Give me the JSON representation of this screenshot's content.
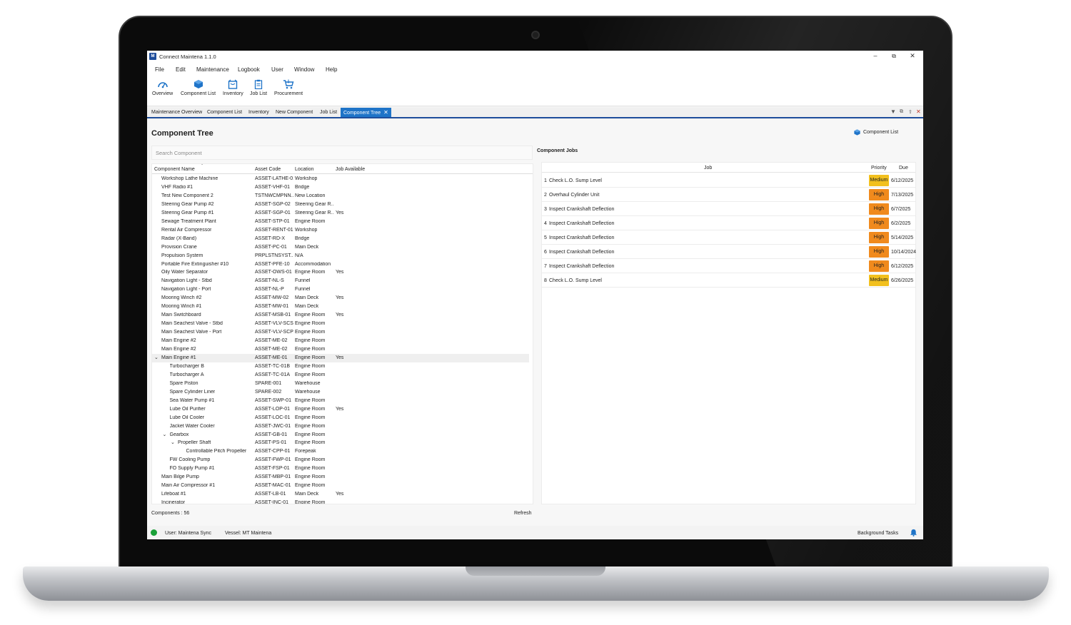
{
  "window": {
    "title": "Connect Maintena 1.1.0",
    "logo_letter": "M"
  },
  "menu": [
    "File",
    "Edit",
    "Maintenance",
    "Logbook",
    "User",
    "Window",
    "Help"
  ],
  "toolbar": [
    {
      "label": "Overview",
      "icon": "gauge-icon"
    },
    {
      "label": "Component List",
      "icon": "cube-icon"
    },
    {
      "label": "Inventory",
      "icon": "inventory-box-icon"
    },
    {
      "label": "Job List",
      "icon": "clipboard-icon"
    },
    {
      "label": "Procurement",
      "icon": "cart-icon"
    }
  ],
  "tabs": [
    {
      "label": "Maintenance Overview",
      "active": false
    },
    {
      "label": "Component List",
      "active": false
    },
    {
      "label": "Inventory",
      "active": false
    },
    {
      "label": "New Component",
      "active": false
    },
    {
      "label": "Job List",
      "active": false
    },
    {
      "label": "Component Tree",
      "active": true,
      "close": "✕"
    }
  ],
  "page": {
    "title": "Component Tree",
    "search_placeholder": "Search Component",
    "component_list_link": "Component List",
    "component_count": "Components : 56",
    "refresh_label": "Refresh"
  },
  "tree": {
    "columns": [
      "Component Name",
      "Asset Code",
      "Location",
      "Job Available"
    ],
    "rows": [
      {
        "name": "Workshop Lathe Machine",
        "code": "ASSET-LATHE-01",
        "location": "Workshop",
        "job": "",
        "level": 0
      },
      {
        "name": "VHF Radio #1",
        "code": "ASSET-VHF-01",
        "location": "Bridge",
        "job": "",
        "level": 0
      },
      {
        "name": "Test New Component 2",
        "code": "TSTNWCMPNN...",
        "location": "New Location",
        "job": "",
        "level": 0
      },
      {
        "name": "Steering Gear Pump #2",
        "code": "ASSET-SGP-02",
        "location": "Steering Gear R...",
        "job": "",
        "level": 0
      },
      {
        "name": "Steering Gear Pump #1",
        "code": "ASSET-SGP-01",
        "location": "Steering Gear R...",
        "job": "Yes",
        "level": 0
      },
      {
        "name": "Sewage Treatment Plant",
        "code": "ASSET-STP-01",
        "location": "Engine Room",
        "job": "",
        "level": 0
      },
      {
        "name": "Rental Air Compressor",
        "code": "ASSET-RENT-01",
        "location": "Workshop",
        "job": "",
        "level": 0
      },
      {
        "name": "Radar (X-Band)",
        "code": "ASSET-RD-X",
        "location": "Bridge",
        "job": "",
        "level": 0
      },
      {
        "name": "Provision Crane",
        "code": "ASSET-PC-01",
        "location": "Main Deck",
        "job": "",
        "level": 0
      },
      {
        "name": "Propulsion System",
        "code": "PRPLSTNSYST...",
        "location": "N/A",
        "job": "",
        "level": 0
      },
      {
        "name": "Portable Fire Extinguisher #10",
        "code": "ASSET-PFE-10",
        "location": "Accommodation",
        "job": "",
        "level": 0
      },
      {
        "name": "Oily Water Separator",
        "code": "ASSET-OWS-01",
        "location": "Engine Room",
        "job": "Yes",
        "level": 0
      },
      {
        "name": "Navigation Light - Stbd",
        "code": "ASSET-NL-S",
        "location": "Funnel",
        "job": "",
        "level": 0
      },
      {
        "name": "Navigation Light - Port",
        "code": "ASSET-NL-P",
        "location": "Funnel",
        "job": "",
        "level": 0
      },
      {
        "name": "Mooring Winch #2",
        "code": "ASSET-MW-02",
        "location": "Main Deck",
        "job": "Yes",
        "level": 0
      },
      {
        "name": "Mooring Winch #1",
        "code": "ASSET-MW-01",
        "location": "Main Deck",
        "job": "",
        "level": 0
      },
      {
        "name": "Main Switchboard",
        "code": "ASSET-MSB-01",
        "location": "Engine Room",
        "job": "Yes",
        "level": 0
      },
      {
        "name": "Main Seachest Valve - Stbd",
        "code": "ASSET-VLV-SCS",
        "location": "Engine Room",
        "job": "",
        "level": 0
      },
      {
        "name": "Main Seachest Valve - Port",
        "code": "ASSET-VLV-SCP",
        "location": "Engine Room",
        "job": "",
        "level": 0
      },
      {
        "name": "Main Engine #2",
        "code": "ASSET-ME-02",
        "location": "Engine Room",
        "job": "",
        "level": 0
      },
      {
        "name": "Main Engine #2",
        "code": "ASSET-ME-02",
        "location": "Engine Room",
        "job": "",
        "level": 0
      },
      {
        "name": "Main Engine #1",
        "code": "ASSET-ME-01",
        "location": "Engine Room",
        "job": "Yes",
        "level": 0,
        "expanded": true,
        "selected": true
      },
      {
        "name": "Turbocharger B",
        "code": "ASSET-TC-01B",
        "location": "Engine Room",
        "job": "",
        "level": 1
      },
      {
        "name": "Turbocharger A",
        "code": "ASSET-TC-01A",
        "location": "Engine Room",
        "job": "",
        "level": 1
      },
      {
        "name": "Spare Piston",
        "code": "SPARE-001",
        "location": "Warehouse",
        "job": "",
        "level": 1
      },
      {
        "name": "Spare Cylinder Liner",
        "code": "SPARE-002",
        "location": "Warehouse",
        "job": "",
        "level": 1
      },
      {
        "name": "Sea Water Pump #1",
        "code": "ASSET-SWP-01",
        "location": "Engine Room",
        "job": "",
        "level": 1
      },
      {
        "name": "Lube Oil Purifier",
        "code": "ASSET-LOP-01",
        "location": "Engine Room",
        "job": "Yes",
        "level": 1
      },
      {
        "name": "Lube Oil Cooler",
        "code": "ASSET-LOC-01",
        "location": "Engine Room",
        "job": "",
        "level": 1
      },
      {
        "name": "Jacket Water Cooler",
        "code": "ASSET-JWC-01",
        "location": "Engine Room",
        "job": "",
        "level": 1
      },
      {
        "name": "Gearbox",
        "code": "ASSET-GB-01",
        "location": "Engine Room",
        "job": "",
        "level": 1,
        "expanded": true
      },
      {
        "name": "Propeller Shaft",
        "code": "ASSET-PS-01",
        "location": "Engine Room",
        "job": "",
        "level": 2,
        "expanded": true
      },
      {
        "name": "Controllable Pitch Propeller",
        "code": "ASSET-CPP-01",
        "location": "Forepeak",
        "job": "",
        "level": 3
      },
      {
        "name": "FW Cooling Pump",
        "code": "ASSET-FWP-01",
        "location": "Engine Room",
        "job": "",
        "level": 1
      },
      {
        "name": "FO Supply Pump #1",
        "code": "ASSET-FSP-01",
        "location": "Engine Room",
        "job": "",
        "level": 1
      },
      {
        "name": "Main Bilge Pump",
        "code": "ASSET-MBP-01",
        "location": "Engine Room",
        "job": "",
        "level": 0
      },
      {
        "name": "Main Air Compressor #1",
        "code": "ASSET-MAC-01",
        "location": "Engine Room",
        "job": "",
        "level": 0
      },
      {
        "name": "Lifeboat #1",
        "code": "ASSET-LB-01",
        "location": "Main Deck",
        "job": "Yes",
        "level": 0
      },
      {
        "name": "Incinerator",
        "code": "ASSET-INC-01",
        "location": "Engine Room",
        "job": "",
        "level": 0
      }
    ]
  },
  "jobs": {
    "title": "Component Jobs",
    "columns": [
      "Job",
      "Priority",
      "Due"
    ],
    "rows": [
      {
        "num": "1",
        "job": "Check L.O. Sump Level",
        "priority": "Medium",
        "due": "6/12/2025"
      },
      {
        "num": "2",
        "job": "Overhaul Cylinder Unit",
        "priority": "High",
        "due": "7/13/2025"
      },
      {
        "num": "3",
        "job": "Inspect Crankshaft Deflection",
        "priority": "High",
        "due": "6/7/2025"
      },
      {
        "num": "4",
        "job": "Inspect Crankshaft Deflection",
        "priority": "High",
        "due": "6/2/2025"
      },
      {
        "num": "5",
        "job": "Inspect Crankshaft Deflection",
        "priority": "High",
        "due": "5/14/2025"
      },
      {
        "num": "6",
        "job": "Inspect Crankshaft Deflection",
        "priority": "High",
        "due": "10/14/2024"
      },
      {
        "num": "7",
        "job": "Inspect Crankshaft Deflection",
        "priority": "High",
        "due": "6/12/2025"
      },
      {
        "num": "8",
        "job": "Check L.O. Sump Level",
        "priority": "Medium",
        "due": "6/26/2025"
      }
    ]
  },
  "status": {
    "user": "User: Maintena Sync",
    "vessel": "Vessel: MT Maintena",
    "background_tasks": "Background Tasks",
    "online_color": "#1aa038"
  },
  "colors": {
    "accent": "#1f74c8",
    "high": "#f08a1d",
    "medium": "#f2c01e"
  }
}
